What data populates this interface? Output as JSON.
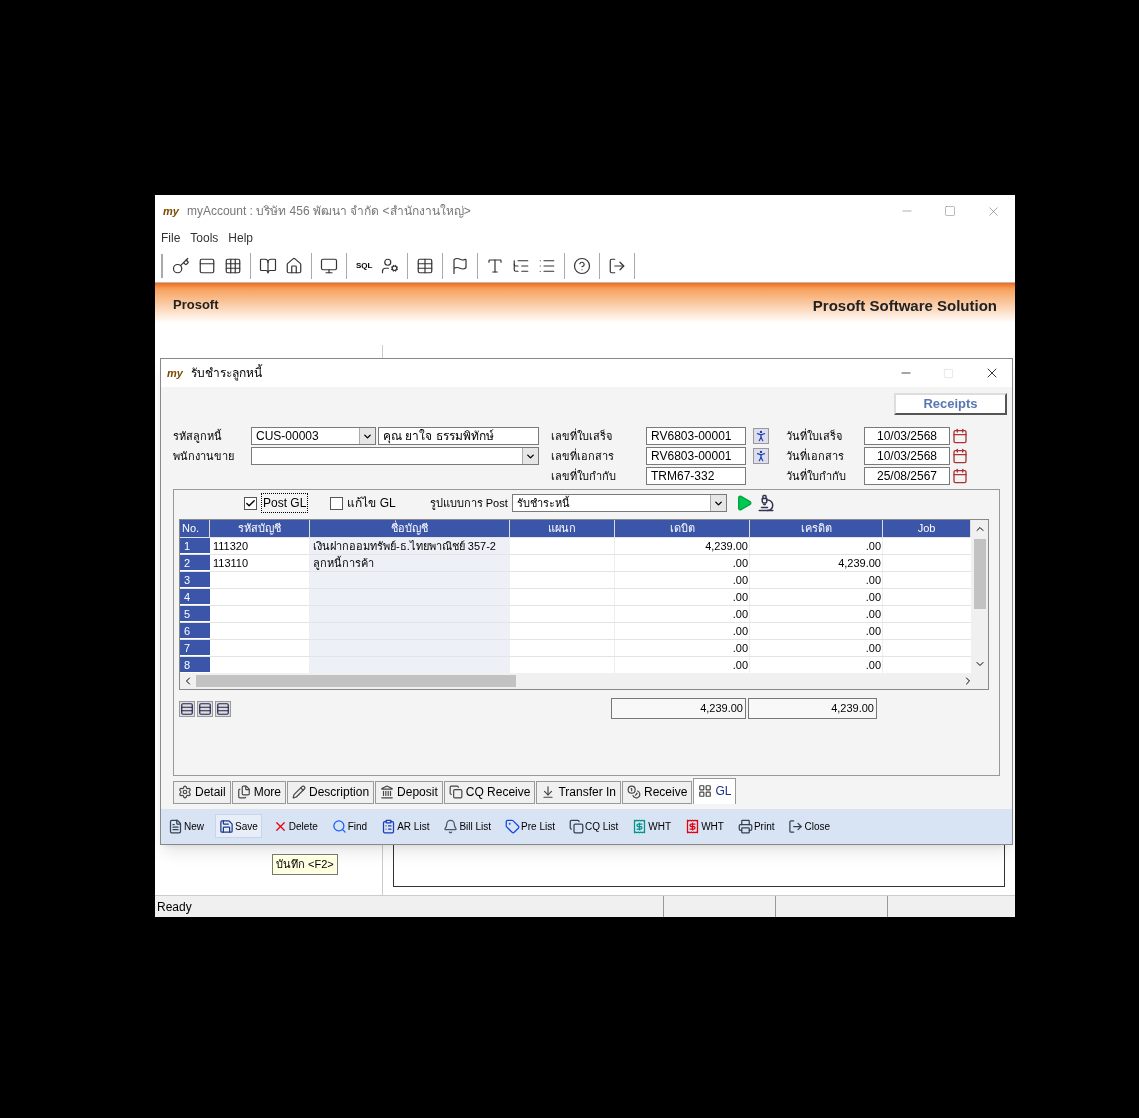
{
  "app_window": {
    "title": "myAccount : บริษัท 456 พัฒนา จำกัด <สำนักงานใหญ่>",
    "logo": "my",
    "menu": [
      "File",
      "Tools",
      "Help"
    ],
    "toolbar_text": "SQL"
  },
  "banner": {
    "brand": "Prosoft",
    "vendor": "Prosoft Software Solution"
  },
  "dialog": {
    "logo": "my",
    "title": "รับชำระลูกหนี้",
    "badge": "Receipts",
    "customer": {
      "label": "รหัสลูกหนี้",
      "code": "CUS-00003",
      "name": "คุณ ยาใจ ธรรมพิทักษ์"
    },
    "salesperson": {
      "label": "พนักงานขาย"
    },
    "documents": [
      {
        "label": "เลขที่ใบเสร็จ",
        "value": "RV6803-00001",
        "lookup": true
      },
      {
        "label": "เลขที่เอกสาร",
        "value": "RV6803-00001",
        "lookup": true
      },
      {
        "label": "เลขที่ใบกำกับ",
        "value": "TRM67-332",
        "lookup": false
      }
    ],
    "dates": [
      {
        "label": "วันที่ใบเสร็จ",
        "value": "10/03/2568"
      },
      {
        "label": "วันที่เอกสาร",
        "value": "10/03/2568"
      },
      {
        "label": "วันที่ใบกำกับ",
        "value": "25/08/2567"
      }
    ],
    "post_gl": {
      "label": "Post GL",
      "checked": true
    },
    "edit_gl": {
      "label": "แก้ไข GL",
      "checked": false
    },
    "post_format": {
      "label": "รูปแบบการ Post",
      "value": "รับชำระหนี้"
    },
    "grid": {
      "columns": [
        "No.",
        "รหัสบัญชี",
        "ชื่อบัญชี",
        "แผนก",
        "เดบิต",
        "เครดิต",
        "Job"
      ],
      "rows": [
        {
          "no": "1",
          "code": "111320",
          "name": "เงินฝากออมทรัพย์-ธ.ไทยพาณิชย์ 357-2",
          "debit": "4,239.00",
          "credit": ".00"
        },
        {
          "no": "2",
          "code": "113110",
          "name": "ลูกหนี้การค้า",
          "debit": ".00",
          "credit": "4,239.00"
        },
        {
          "no": "3",
          "debit": ".00",
          "credit": ".00"
        },
        {
          "no": "4",
          "debit": ".00",
          "credit": ".00"
        },
        {
          "no": "5",
          "debit": ".00",
          "credit": ".00"
        },
        {
          "no": "6",
          "debit": ".00",
          "credit": ".00"
        },
        {
          "no": "7",
          "debit": ".00",
          "credit": ".00"
        },
        {
          "no": "8",
          "debit": ".00",
          "credit": ".00"
        }
      ],
      "totals": [
        "4,239.00",
        "4,239.00"
      ]
    },
    "tabs": [
      {
        "label": "Detail",
        "selected": false
      },
      {
        "label": "More",
        "selected": false
      },
      {
        "label": "Description",
        "selected": false
      },
      {
        "label": "Deposit",
        "selected": false
      },
      {
        "label": "CQ Receive",
        "selected": false
      },
      {
        "label": "Transfer In",
        "selected": false
      },
      {
        "label": "Receive",
        "selected": false
      },
      {
        "label": "GL",
        "selected": true
      }
    ],
    "actions": [
      "New",
      "Save",
      "Delete",
      "Find",
      "AR List",
      "Bill List",
      "Pre List",
      "CQ List",
      "WHT",
      "WHT",
      "Print",
      "Close"
    ]
  },
  "tooltip": "บันทึก <F2>",
  "status_bar": {
    "text": "Ready"
  }
}
